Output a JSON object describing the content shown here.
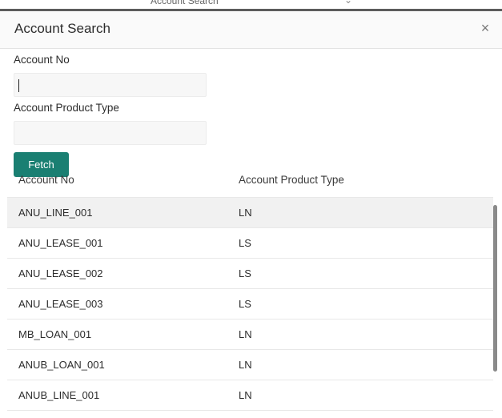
{
  "background": {
    "title_fragment": "Account Search",
    "chevron": "chevron-down-icon"
  },
  "modal": {
    "title": "Account Search",
    "close_symbol": "×"
  },
  "form": {
    "account_no_label": "Account No",
    "account_no_value": "",
    "account_product_type_label": "Account Product Type",
    "account_product_type_value": "",
    "fetch_label": "Fetch"
  },
  "table": {
    "headers": [
      "Account No",
      "Account Product Type"
    ],
    "rows": [
      {
        "account_no": "ANU_LINE_001",
        "product_type": "LN"
      },
      {
        "account_no": "ANU_LEASE_001",
        "product_type": "LS"
      },
      {
        "account_no": "ANU_LEASE_002",
        "product_type": "LS"
      },
      {
        "account_no": "ANU_LEASE_003",
        "product_type": "LS"
      },
      {
        "account_no": "MB_LOAN_001",
        "product_type": "LN"
      },
      {
        "account_no": "ANUB_LOAN_001",
        "product_type": "LN"
      },
      {
        "account_no": "ANUB_LINE_001",
        "product_type": "LN"
      }
    ]
  },
  "colors": {
    "fetch_button": "#1a7f72",
    "selected_row": "#f1f1f1"
  }
}
